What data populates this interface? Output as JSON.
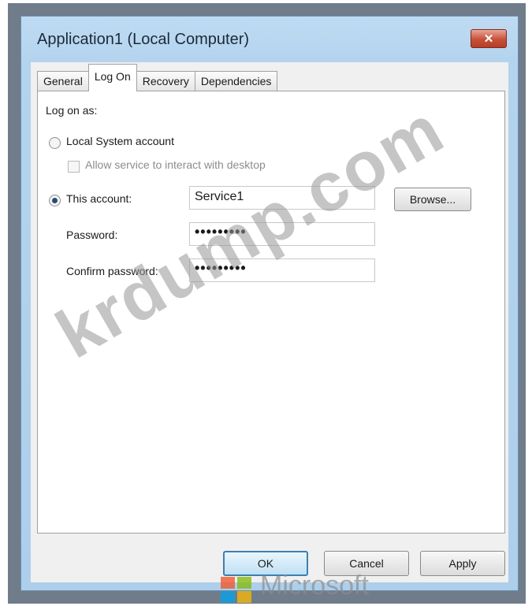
{
  "window": {
    "title": "Application1 (Local Computer)",
    "close_glyph": "✕"
  },
  "tabs": [
    {
      "label": "General"
    },
    {
      "label": "Log On"
    },
    {
      "label": "Recovery"
    },
    {
      "label": "Dependencies"
    }
  ],
  "logon": {
    "log_on_as": "Log on as:",
    "local_system_label": "Local System account",
    "allow_interact_label": "Allow service to interact with desktop",
    "this_account_label": "This account:",
    "this_account_value": "Service1",
    "browse_label": "Browse...",
    "password_label": "Password:",
    "password_value": "•••••••••",
    "confirm_label": "Confirm password:",
    "confirm_value": "•••••••••"
  },
  "buttons": {
    "ok": "OK",
    "cancel": "Cancel",
    "apply": "Apply"
  },
  "overlay": {
    "watermark": "krdump.com",
    "brand": "Microsoft"
  },
  "colors": {
    "title_bar": "#b3d3ee",
    "close": "#c75039",
    "accent": "#3c7fb1"
  },
  "icons": {
    "close": "close-icon",
    "logo": "microsoft-logo"
  }
}
